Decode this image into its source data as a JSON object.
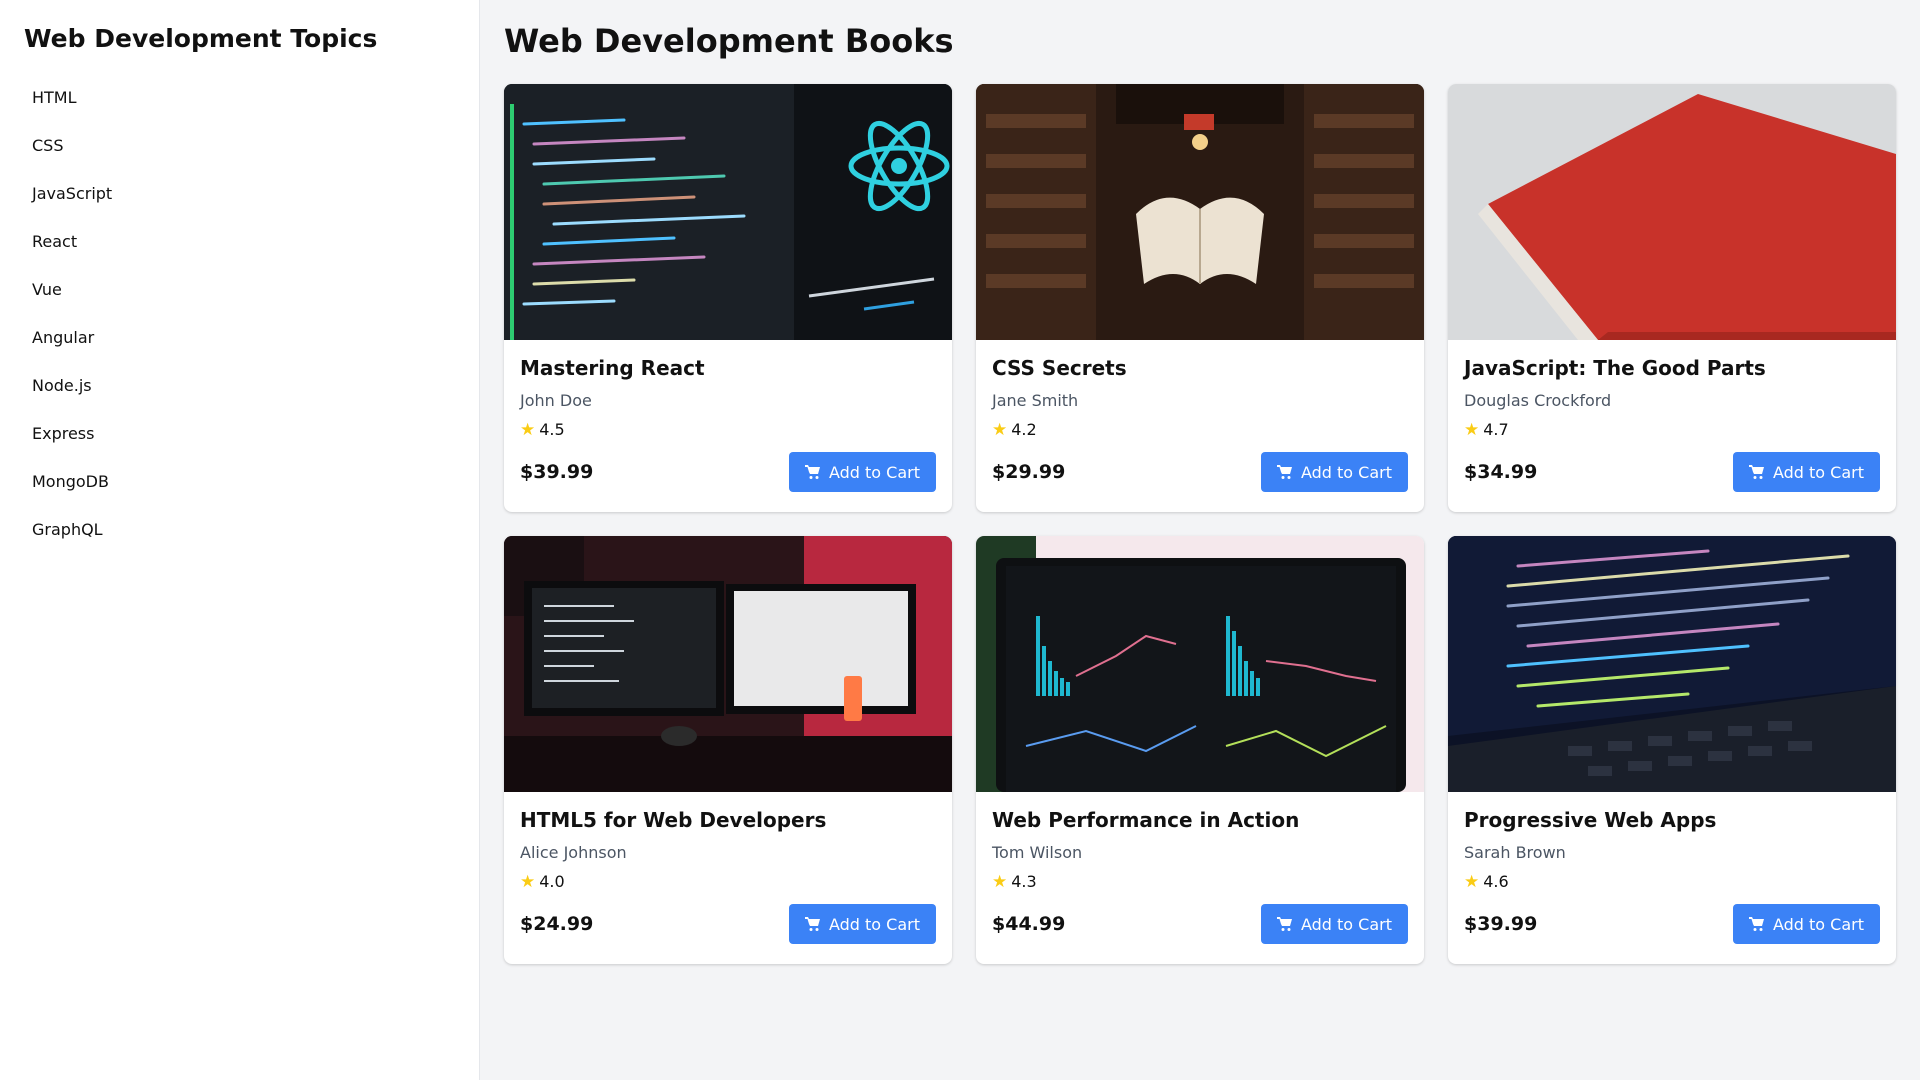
{
  "sidebar": {
    "title": "Web Development Topics",
    "topics": [
      "HTML",
      "CSS",
      "JavaScript",
      "React",
      "Vue",
      "Angular",
      "Node.js",
      "Express",
      "MongoDB",
      "GraphQL"
    ]
  },
  "main": {
    "title": "Web Development Books",
    "books": [
      {
        "title": "Mastering React",
        "author": "John Doe",
        "rating": "4.5",
        "price": "$39.99",
        "button": "Add to Cart",
        "image": "react-code-screen"
      },
      {
        "title": "CSS Secrets",
        "author": "Jane Smith",
        "rating": "4.2",
        "price": "$29.99",
        "button": "Add to Cart",
        "image": "library-floating-book"
      },
      {
        "title": "JavaScript: The Good Parts",
        "author": "Douglas Crockford",
        "rating": "4.7",
        "price": "$34.99",
        "button": "Add to Cart",
        "image": "red-book-cover"
      },
      {
        "title": "HTML5 for Web Developers",
        "author": "Alice Johnson",
        "rating": "4.0",
        "price": "$24.99",
        "button": "Add to Cart",
        "image": "dual-monitor-desk"
      },
      {
        "title": "Web Performance in Action",
        "author": "Tom Wilson",
        "rating": "4.3",
        "price": "$44.99",
        "button": "Add to Cart",
        "image": "analytics-dashboard-laptop"
      },
      {
        "title": "Progressive Web Apps",
        "author": "Sarah Brown",
        "rating": "4.6",
        "price": "$39.99",
        "button": "Add to Cart",
        "image": "code-laptop-keyboard"
      }
    ]
  },
  "colors": {
    "accent": "#3b82f6",
    "star": "#facc15",
    "background": "#f3f4f6"
  },
  "icons": {
    "rating": "star-icon",
    "cart": "cart-icon"
  }
}
